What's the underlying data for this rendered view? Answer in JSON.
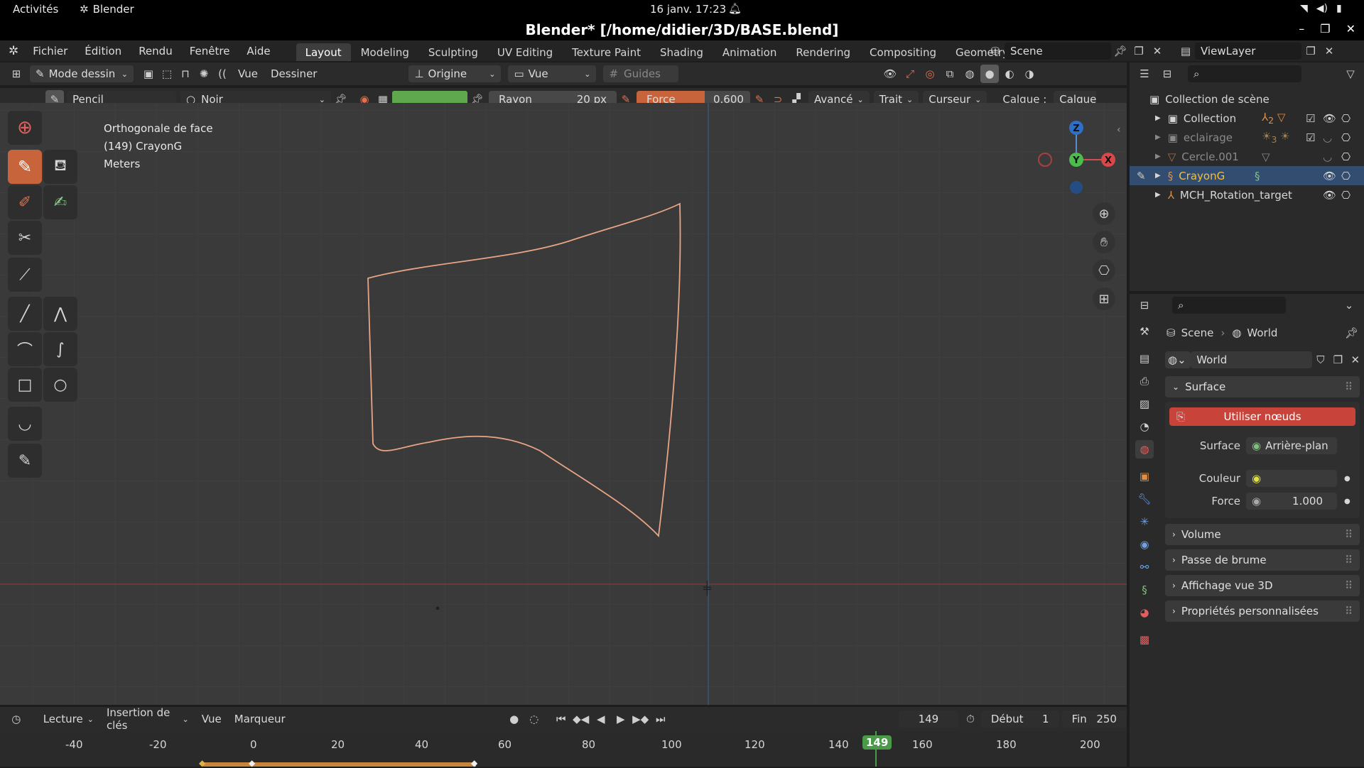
{
  "system": {
    "activities": "Activités",
    "app": "Blender",
    "datetime": "16 janv.  17:23"
  },
  "window": {
    "title": "Blender* [/home/didier/3D/BASE.blend]"
  },
  "menus": [
    "Fichier",
    "Édition",
    "Rendu",
    "Fenêtre",
    "Aide"
  ],
  "workspaces": [
    "Layout",
    "Modeling",
    "Sculpting",
    "UV Editing",
    "Texture Paint",
    "Shading",
    "Animation",
    "Rendering",
    "Compositing",
    "Geometry N"
  ],
  "scene": {
    "name": "Scene",
    "viewlayer": "ViewLayer"
  },
  "viewport_header": {
    "mode": "Mode dessin",
    "vue": "Vue",
    "dessiner": "Dessiner",
    "origine": "Origine",
    "view_select": "Vue",
    "guides": "Guides"
  },
  "tool_header": {
    "brush": "Pencil",
    "material": "Noir",
    "rayon_label": "Rayon",
    "rayon_value": "20 px",
    "force_label": "Force",
    "force_value": "0.600",
    "avance": "Avancé",
    "trait": "Trait",
    "curseur": "Curseur",
    "calque_label": "Calque :",
    "calque_value": "Calque"
  },
  "overlay": {
    "line1": "Orthogonale de face",
    "line2": "(149) CrayonG",
    "line3": "Meters"
  },
  "gizmo": {
    "z": "Z",
    "y": "Y",
    "x": "X"
  },
  "outliner": {
    "root": "Collection de scène",
    "items": [
      {
        "label": "Collection",
        "sub": "2"
      },
      {
        "label": "eclairage",
        "sub": "3"
      },
      {
        "label": "Cercle.001"
      },
      {
        "label": "CrayonG"
      },
      {
        "label": "MCH_Rotation_target"
      }
    ]
  },
  "properties": {
    "breadcrumb_scene": "Scene",
    "breadcrumb_world": "World",
    "world_name": "World",
    "surface_panel": "Surface",
    "use_nodes": "Utiliser nœuds",
    "surface_label": "Surface",
    "surface_value": "Arrière-plan",
    "color_label": "Couleur",
    "force_label": "Force",
    "force_value": "1.000",
    "panels": [
      "Volume",
      "Passe de brume",
      "Affichage vue 3D",
      "Propriétés personnalisées"
    ]
  },
  "timeline": {
    "lecture": "Lecture",
    "insertion": "Insertion de clés",
    "vue": "Vue",
    "marqueur": "Marqueur",
    "current": "149",
    "debut_label": "Début",
    "debut": "1",
    "fin_label": "Fin",
    "fin": "250",
    "ticks": [
      "-40",
      "-20",
      "0",
      "20",
      "40",
      "60",
      "80",
      "100",
      "120",
      "140",
      "160",
      "180",
      "200"
    ],
    "current_tick": "149"
  },
  "colors": {
    "accent": "#c8643b",
    "stroke": "#e8a585",
    "active_frame": "#4a9a4a"
  }
}
